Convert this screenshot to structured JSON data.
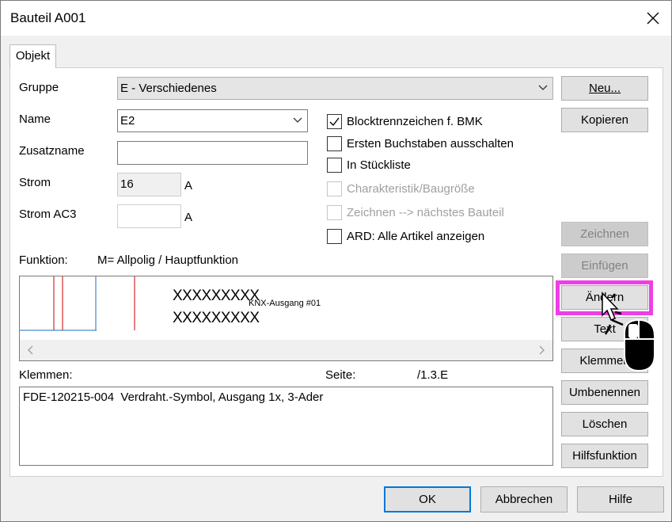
{
  "window": {
    "title": "Bauteil A001"
  },
  "tabs": [
    {
      "label": "Objekt"
    }
  ],
  "form": {
    "gruppe_label": "Gruppe",
    "gruppe_value": "E - Verschiedenes",
    "name_label": "Name",
    "name_value": "E2",
    "zusatzname_label": "Zusatzname",
    "zusatzname_value": "",
    "strom_label": "Strom",
    "strom_value": "16",
    "strom_unit": "A",
    "strom_ac3_label": "Strom AC3",
    "strom_ac3_value": "",
    "strom_ac3_unit": "A",
    "funktion_label": "Funktion:",
    "funktion_value": "M= Allpolig / Hauptfunktion",
    "klemmen_label": "Klemmen:",
    "seite_label": "Seite:",
    "seite_value": "/1.3.E",
    "klemmen_text": "FDE-120215-004  Verdraht.-Symbol, Ausgang 1x, 3-Ader"
  },
  "checkboxes": [
    {
      "label": "Blocktrennzeichen f. BMK",
      "checked": true,
      "enabled": true
    },
    {
      "label": "Ersten Buchstaben ausschalten",
      "checked": false,
      "enabled": true
    },
    {
      "label": "In Stückliste",
      "checked": false,
      "enabled": true
    },
    {
      "label": "Charakteristik/Baugröße",
      "checked": false,
      "enabled": false
    },
    {
      "label": "Zeichnen --> nächstes Bauteil",
      "checked": false,
      "enabled": false
    },
    {
      "label": "ARD: Alle Artikel anzeigen",
      "checked": false,
      "enabled": true
    }
  ],
  "preview": {
    "line1": "XXXXXXXXX",
    "subscript": "KNX-Ausgang #01",
    "line2": "XXXXXXXXX"
  },
  "side_buttons": [
    {
      "label": "Neu...",
      "enabled": true
    },
    {
      "label": "Kopieren",
      "enabled": true
    },
    {
      "label": "Zeichnen",
      "enabled": false
    },
    {
      "label": "Einfügen",
      "enabled": false
    },
    {
      "label": "Ändern",
      "enabled": true
    },
    {
      "label": "Text",
      "enabled": true
    },
    {
      "label": "Klemmen",
      "enabled": true
    },
    {
      "label": "Umbenennen",
      "enabled": true
    },
    {
      "label": "Löschen",
      "enabled": true
    },
    {
      "label": "Hilfsfunktion",
      "enabled": true
    }
  ],
  "footer": {
    "ok": "OK",
    "cancel": "Abbrechen",
    "help": "Hilfe"
  },
  "colors": {
    "highlight": "#ef3ee5",
    "focus_border": "#0078d7",
    "preview_red": "#cc0000",
    "preview_blue": "#1f6fbf"
  }
}
